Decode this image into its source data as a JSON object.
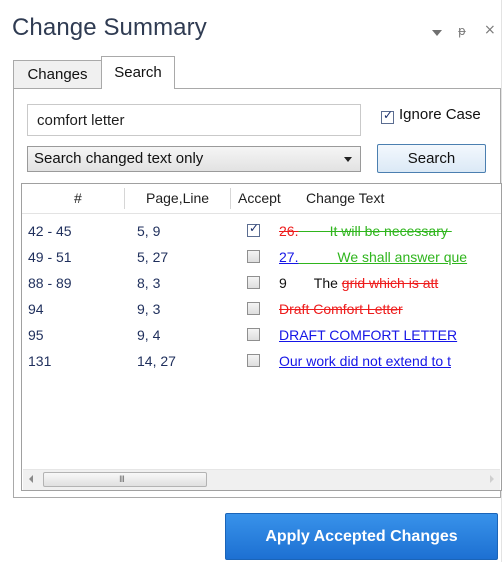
{
  "panel": {
    "title": "Change Summary",
    "controls": {
      "dropdown_icon": "caret-down-icon",
      "pin_glyph": "ᵽ",
      "close_glyph": "×"
    }
  },
  "tabs": [
    {
      "label": "Changes",
      "selected": false
    },
    {
      "label": "Search",
      "selected": true
    }
  ],
  "search": {
    "query": "comfort letter",
    "ignore_case_label": "Ignore Case",
    "ignore_case_checked": true,
    "scope_value": "Search changed text only",
    "search_button": "Search"
  },
  "grid": {
    "columns": [
      "#",
      "Page,Line",
      "Accept",
      "Change Text"
    ],
    "rows": [
      {
        "num": "42 - 45",
        "page_line": "5, 9",
        "accepted": true,
        "seg": [
          {
            "text": "26.",
            "color": "red",
            "deco": "strike"
          },
          {
            "text": "        It will be necessary ",
            "color": "green",
            "deco": "strike"
          }
        ]
      },
      {
        "num": "49 - 51",
        "page_line": "5, 27",
        "accepted": false,
        "seg": [
          {
            "text": "27.",
            "color": "blue",
            "deco": "uline"
          },
          {
            "text": "          We shall answer que",
            "color": "green",
            "deco": "uline"
          }
        ]
      },
      {
        "num": "88 - 89",
        "page_line": "8, 3",
        "accepted": false,
        "seg": [
          {
            "text": "9",
            "color": "black",
            "deco": ""
          },
          {
            "text": "       The ",
            "color": "black",
            "deco": ""
          },
          {
            "text": "grid which is att",
            "color": "red",
            "deco": "strike"
          }
        ]
      },
      {
        "num": "94",
        "page_line": "9, 3",
        "accepted": false,
        "seg": [
          {
            "text": "Draft Comfort Letter",
            "color": "red",
            "deco": "strike"
          }
        ]
      },
      {
        "num": "95",
        "page_line": "9, 4",
        "accepted": false,
        "seg": [
          {
            "text": "DRAFT COMFORT LETTER",
            "color": "blue",
            "deco": "uline"
          }
        ]
      },
      {
        "num": "131",
        "page_line": "14, 27",
        "accepted": false,
        "seg": [
          {
            "text": "Our work did not extend to t",
            "color": "blue",
            "deco": "uline"
          }
        ]
      }
    ],
    "scroll_grip": "III"
  },
  "apply_button": "Apply Accepted Changes",
  "colors": {
    "title": "#2f3b52",
    "deleted": "#ee1c1c",
    "inserted_green": "#2fb51d",
    "inserted_blue": "#1515e6",
    "apply_button_bg": "#1d70d2"
  }
}
